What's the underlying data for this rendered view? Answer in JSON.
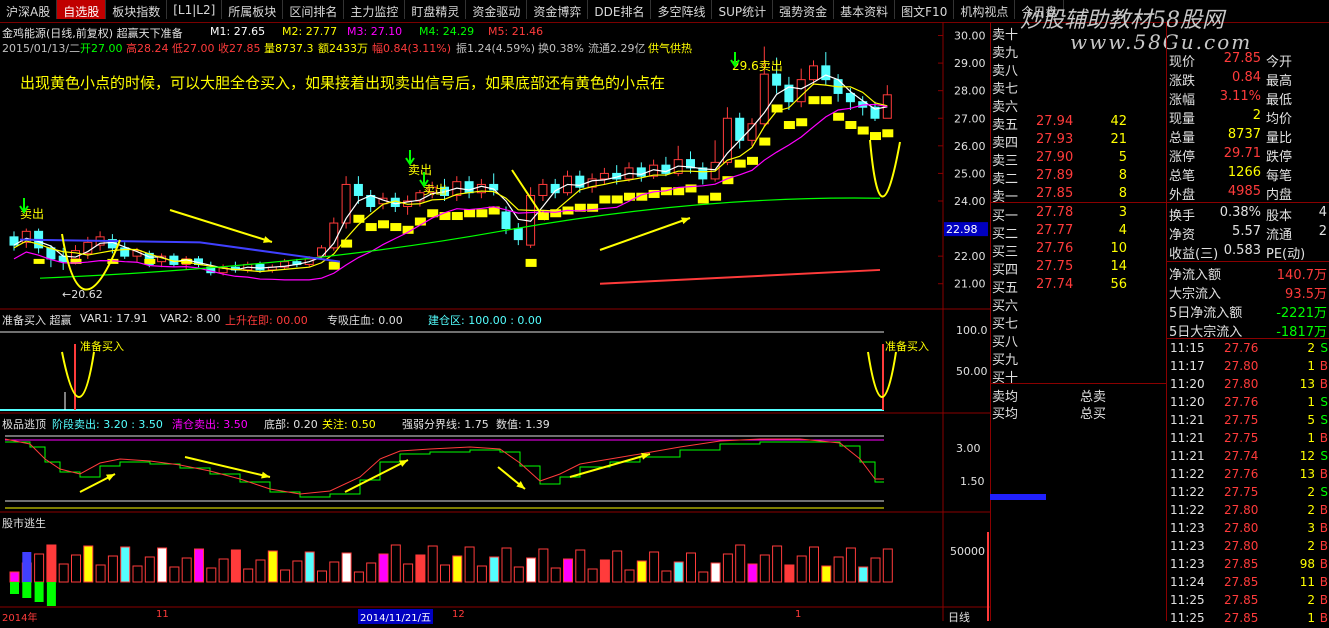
{
  "menu": [
    "沪深A股",
    "自选股",
    "板块指数",
    "[L1|L2]",
    "所属板块",
    "区间排名",
    "主力监控",
    "盯盘精灵",
    "资金驱动",
    "资金博弈",
    "DDE排名",
    "多空阵线",
    "SUP统计",
    "强势资金",
    "基本资料",
    "图文F10",
    "机构视点",
    "今日盘"
  ],
  "active_menu_index": 1,
  "watermark": {
    "line1": "炒股辅助教材58股网",
    "line2": "www.58Gu.com"
  },
  "stock_header": {
    "name": "金鸡能源(日线,前复权) 超赢天下准备",
    "m1": "M1: 27.65",
    "m2": "M2: 27.77",
    "m3": "M3: 27.10",
    "m4": "M4: 24.29",
    "m5": "M5: 21.46"
  },
  "info_line": {
    "date": "2015/01/13/二",
    "open": "开27.00",
    "high": "高28.24",
    "low": "低27.00",
    "close": "收27.85",
    "vol": "量8737.3",
    "amount": "额2433万",
    "change": "幅0.84(3.11%)",
    "amp": "振1.24(4.59%)",
    "turnover": "换0.38%",
    "float": "流通2.29亿",
    "tag": "供气供热"
  },
  "annotation": "出现黄色小点的时候，可以大胆全仓买入，如果接着出现卖出信号后，如果底部还有黄色的小点在",
  "main_chart": {
    "labels": {
      "sell1": "卖出",
      "sell2": "卖出",
      "sell3": "卖出",
      "sell4": "29.6卖出",
      "low_price": "20.62"
    },
    "y_axis": [
      "30.00",
      "29.00",
      "28.00",
      "27.00",
      "26.00",
      "25.00",
      "24.00",
      "22.98",
      "22.00",
      "21.00"
    ],
    "price_tag": "22.98"
  },
  "pane2": {
    "header": [
      "准备买入 超赢",
      "VAR1: 17.91",
      "VAR2: 8.00",
      "上升在即: 00.00",
      "专吸庄血: 0.00",
      "建仓区: 100.00 : 0.00"
    ],
    "labels": {
      "buy_left": "准备买入",
      "buy_right": "准备买入"
    },
    "y_axis": [
      "100.0",
      "50.00"
    ]
  },
  "pane3": {
    "header": [
      "极品逃顶",
      "阶段卖出: 3.20 : 3.50",
      "清仓卖出: 3.50",
      "底部: 0.20",
      "关注: 0.50",
      "强弱分界线: 1.75",
      "数值: 1.39"
    ],
    "y_axis": [
      "3.00",
      "1.50"
    ]
  },
  "pane4": {
    "header": "股市逃生",
    "y_axis": [
      "50000"
    ]
  },
  "bottom_axis": {
    "year": "2014年",
    "m11": "11",
    "date": "2014/11/21/五",
    "m12": "12",
    "m1": "1",
    "period": "日线"
  },
  "order_book": {
    "sell": [
      {
        "label": "卖十",
        "price": "",
        "vol": ""
      },
      {
        "label": "卖九",
        "price": "",
        "vol": ""
      },
      {
        "label": "卖八",
        "price": "",
        "vol": ""
      },
      {
        "label": "卖七",
        "price": "",
        "vol": ""
      },
      {
        "label": "卖六",
        "price": "",
        "vol": ""
      },
      {
        "label": "卖五",
        "price": "27.94",
        "vol": "42"
      },
      {
        "label": "卖四",
        "price": "27.93",
        "vol": "21"
      },
      {
        "label": "卖三",
        "price": "27.90",
        "vol": "5"
      },
      {
        "label": "卖二",
        "price": "27.89",
        "vol": "8"
      },
      {
        "label": "卖一",
        "price": "27.85",
        "vol": "8"
      }
    ],
    "buy": [
      {
        "label": "买一",
        "price": "27.78",
        "vol": "3"
      },
      {
        "label": "买二",
        "price": "27.77",
        "vol": "4"
      },
      {
        "label": "买三",
        "price": "27.76",
        "vol": "10"
      },
      {
        "label": "买四",
        "price": "27.75",
        "vol": "14"
      },
      {
        "label": "买五",
        "price": "27.74",
        "vol": "56"
      },
      {
        "label": "买六",
        "price": "",
        "vol": ""
      },
      {
        "label": "买七",
        "price": "",
        "vol": ""
      },
      {
        "label": "买八",
        "price": "",
        "vol": ""
      },
      {
        "label": "买九",
        "price": "",
        "vol": ""
      },
      {
        "label": "买十",
        "price": "",
        "vol": ""
      }
    ],
    "avg_sell": "卖均",
    "avg_buy": "买均",
    "total_sell": "总卖",
    "total_buy": "总买"
  },
  "quote": [
    {
      "l": "现价",
      "v": "27.85",
      "r": "今开"
    },
    {
      "l": "涨跌",
      "v": "0.84",
      "r": "最高"
    },
    {
      "l": "涨幅",
      "v": "3.11%",
      "r": "最低"
    },
    {
      "l": "现量",
      "v": "2",
      "r": "均价"
    },
    {
      "l": "总量",
      "v": "8737",
      "r": "量比"
    },
    {
      "l": "涨停",
      "v": "29.71",
      "r": "跌停"
    },
    {
      "l": "总笔",
      "v": "1266",
      "r": "每笔"
    },
    {
      "l": "外盘",
      "v": "4985",
      "r": "内盘"
    }
  ],
  "quote2": [
    {
      "l": "换手",
      "v": "0.38%",
      "r": "股本",
      "x": "4"
    },
    {
      "l": "净资",
      "v": "5.57",
      "r": "流通",
      "x": "2"
    },
    {
      "l": "收益(三)",
      "v": "0.583",
      "r": "PE(动)",
      "x": ""
    }
  ],
  "flows": [
    {
      "l": "净流入额",
      "v": "140.7万"
    },
    {
      "l": "大宗流入",
      "v": "93.5万"
    },
    {
      "l": "5日净流入额",
      "v": "-2221万"
    },
    {
      "l": "5日大宗流入",
      "v": "-1817万"
    }
  ],
  "ticks": [
    {
      "t": "11:15",
      "p": "27.76",
      "v": "2",
      "d": "S"
    },
    {
      "t": "11:17",
      "p": "27.80",
      "v": "1",
      "d": "B"
    },
    {
      "t": "11:20",
      "p": "27.80",
      "v": "13",
      "d": "B"
    },
    {
      "t": "11:20",
      "p": "27.76",
      "v": "1",
      "d": "S"
    },
    {
      "t": "11:21",
      "p": "27.75",
      "v": "5",
      "d": "S"
    },
    {
      "t": "11:21",
      "p": "27.75",
      "v": "1",
      "d": "B"
    },
    {
      "t": "11:21",
      "p": "27.74",
      "v": "12",
      "d": "S"
    },
    {
      "t": "11:22",
      "p": "27.76",
      "v": "13",
      "d": "B"
    },
    {
      "t": "11:22",
      "p": "27.75",
      "v": "2",
      "d": "S"
    },
    {
      "t": "11:22",
      "p": "27.80",
      "v": "2",
      "d": "B"
    },
    {
      "t": "11:23",
      "p": "27.80",
      "v": "3",
      "d": "B"
    },
    {
      "t": "11:23",
      "p": "27.80",
      "v": "2",
      "d": "B"
    },
    {
      "t": "11:23",
      "p": "27.85",
      "v": "98",
      "d": "B"
    },
    {
      "t": "11:24",
      "p": "27.85",
      "v": "11",
      "d": "B"
    },
    {
      "t": "11:25",
      "p": "27.85",
      "v": "2",
      "d": "B"
    },
    {
      "t": "11:25",
      "p": "27.85",
      "v": "1",
      "d": "B"
    }
  ],
  "colors": {
    "up": "#ff3b3b",
    "down": "#54ffff",
    "yellow": "#ffff00",
    "green": "#00ff00",
    "magenta": "#ff00ff",
    "grid": "#8a0000"
  }
}
